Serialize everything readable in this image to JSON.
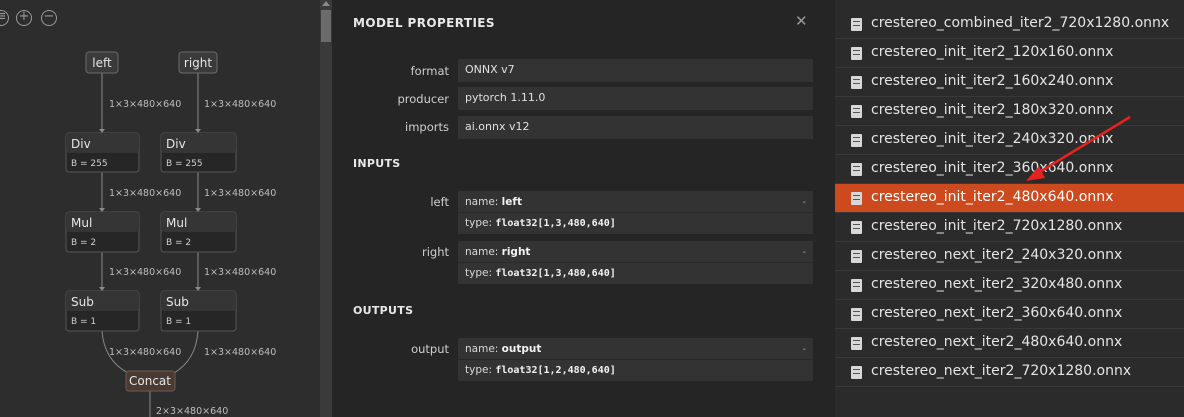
{
  "toolbar": {
    "icons": [
      "list-icon",
      "zoom-in-icon",
      "zoom-out-icon"
    ]
  },
  "graph": {
    "inputs": [
      "left",
      "right"
    ],
    "ops": [
      {
        "name": "Div",
        "attr": "B = 255"
      },
      {
        "name": "Div",
        "attr": "B = 255"
      },
      {
        "name": "Mul",
        "attr": "B = 2"
      },
      {
        "name": "Mul",
        "attr": "B = 2"
      },
      {
        "name": "Sub",
        "attr": "B = 1"
      },
      {
        "name": "Sub",
        "attr": "B = 1"
      }
    ],
    "concat": "Concat",
    "edge_label": "1×3×480×640",
    "output_edge_label": "2×3×480×640"
  },
  "properties": {
    "title": "MODEL PROPERTIES",
    "close": "✕",
    "rows": [
      {
        "label": "format",
        "value": "ONNX v7"
      },
      {
        "label": "producer",
        "value": "pytorch 1.11.0"
      },
      {
        "label": "imports",
        "value": "ai.onnx v12"
      }
    ],
    "inputs_title": "INPUTS",
    "inputs": [
      {
        "label": "left",
        "name_prefix": "name: ",
        "name": "left",
        "type_prefix": "type: ",
        "type": "float32[1,3,480,640]",
        "dash": "-"
      },
      {
        "label": "right",
        "name_prefix": "name: ",
        "name": "right",
        "type_prefix": "type: ",
        "type": "float32[1,3,480,640]",
        "dash": "-"
      }
    ],
    "outputs_title": "OUTPUTS",
    "outputs": [
      {
        "label": "output",
        "name_prefix": "name: ",
        "name": "output",
        "type_prefix": "type: ",
        "type": "float32[1,2,480,640]",
        "dash": "-"
      }
    ]
  },
  "files": {
    "items": [
      "crestereo_combined_iter2_720x1280.onnx",
      "crestereo_init_iter2_120x160.onnx",
      "crestereo_init_iter2_160x240.onnx",
      "crestereo_init_iter2_180x320.onnx",
      "crestereo_init_iter2_240x320.onnx",
      "crestereo_init_iter2_360x640.onnx",
      "crestereo_init_iter2_480x640.onnx",
      "crestereo_init_iter2_720x1280.onnx",
      "crestereo_next_iter2_240x320.onnx",
      "crestereo_next_iter2_320x480.onnx",
      "crestereo_next_iter2_360x640.onnx",
      "crestereo_next_iter2_480x640.onnx",
      "crestereo_next_iter2_720x1280.onnx"
    ],
    "selected_index": 6,
    "selected_color": "#cc4a1d",
    "arrow_color": "#e8231f"
  }
}
